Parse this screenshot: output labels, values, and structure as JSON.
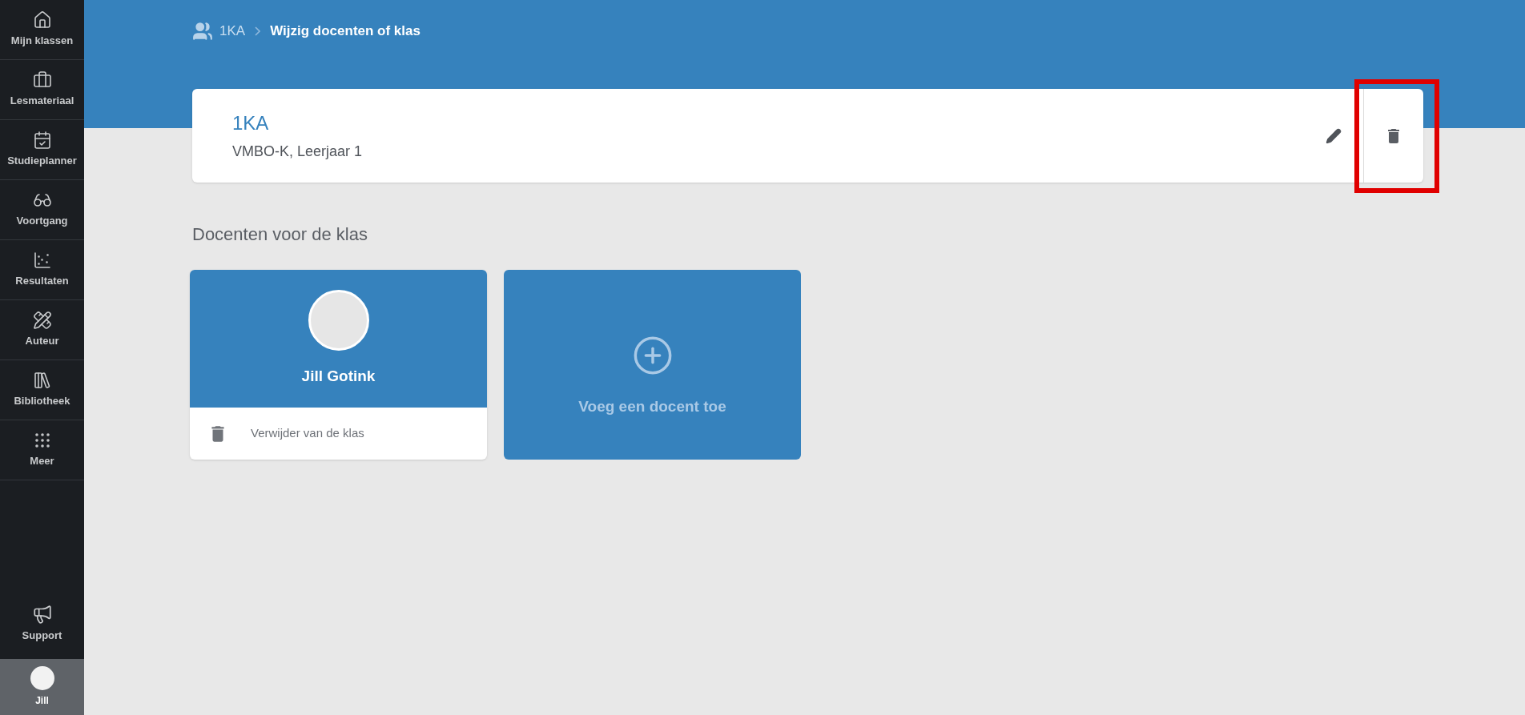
{
  "sidebar": {
    "items": [
      {
        "label": "Mijn klassen"
      },
      {
        "label": "Lesmateriaal"
      },
      {
        "label": "Studieplanner"
      },
      {
        "label": "Voortgang"
      },
      {
        "label": "Resultaten"
      },
      {
        "label": "Auteur"
      },
      {
        "label": "Bibliotheek"
      },
      {
        "label": "Meer"
      }
    ],
    "support": {
      "label": "Support"
    },
    "user": {
      "label": "Jill",
      "selected": true
    }
  },
  "breadcrumb": {
    "items": [
      "1KA",
      "Wijzig docenten of klas"
    ]
  },
  "class_card": {
    "title": "1KA",
    "subtitle": "VMBO-K, Leerjaar 1",
    "delete_highlighted": true
  },
  "section_title": "Docenten voor de klas",
  "teachers": [
    {
      "name": "Jill Gotink",
      "remove_label": "Verwijder van de klas"
    }
  ],
  "add_teacher": {
    "label": "Voeg een docent toe"
  }
}
